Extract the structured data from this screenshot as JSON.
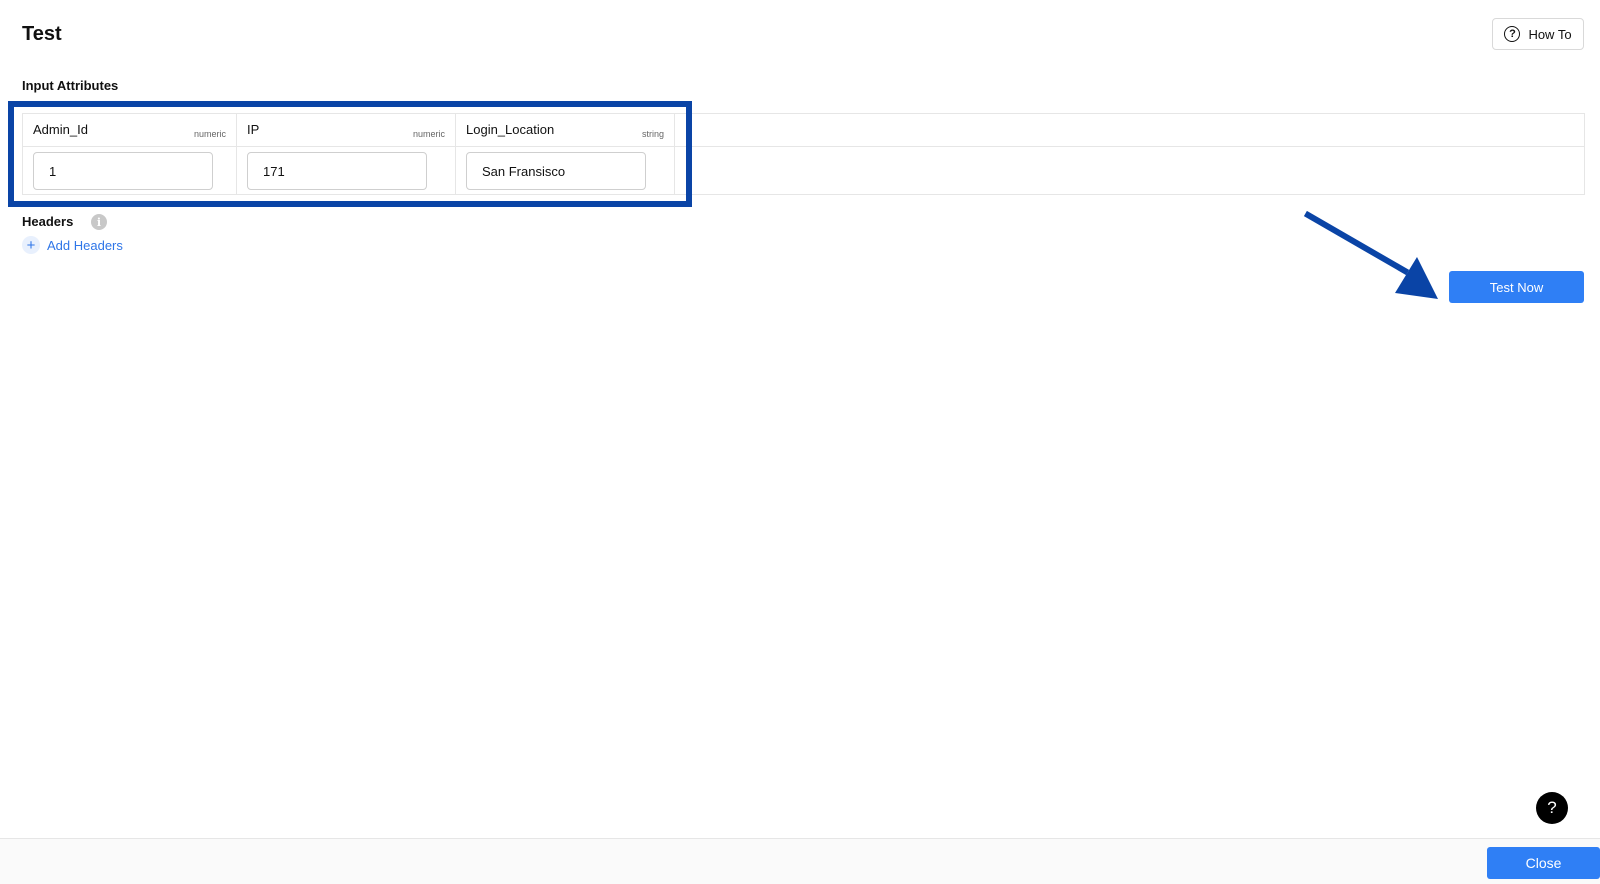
{
  "header": {
    "title": "Test",
    "howto_label": "How To",
    "howto_icon": "help-circle-icon"
  },
  "input_attributes": {
    "label": "Input Attributes",
    "columns": [
      {
        "name": "Admin_Id",
        "type": "numeric",
        "value": "1"
      },
      {
        "name": "IP",
        "type": "numeric",
        "value": "171"
      },
      {
        "name": "Login_Location",
        "type": "string",
        "value": "San Fransisco"
      }
    ]
  },
  "headers": {
    "label": "Headers",
    "info_icon": "info-icon",
    "add_label": "Add Headers",
    "add_icon": "plus-icon"
  },
  "actions": {
    "test_now_label": "Test Now",
    "close_label": "Close",
    "help_glyph": "?"
  },
  "colors": {
    "primary": "#2f7ff5",
    "link": "#2f76e8",
    "annotation": "#0a44a6"
  }
}
